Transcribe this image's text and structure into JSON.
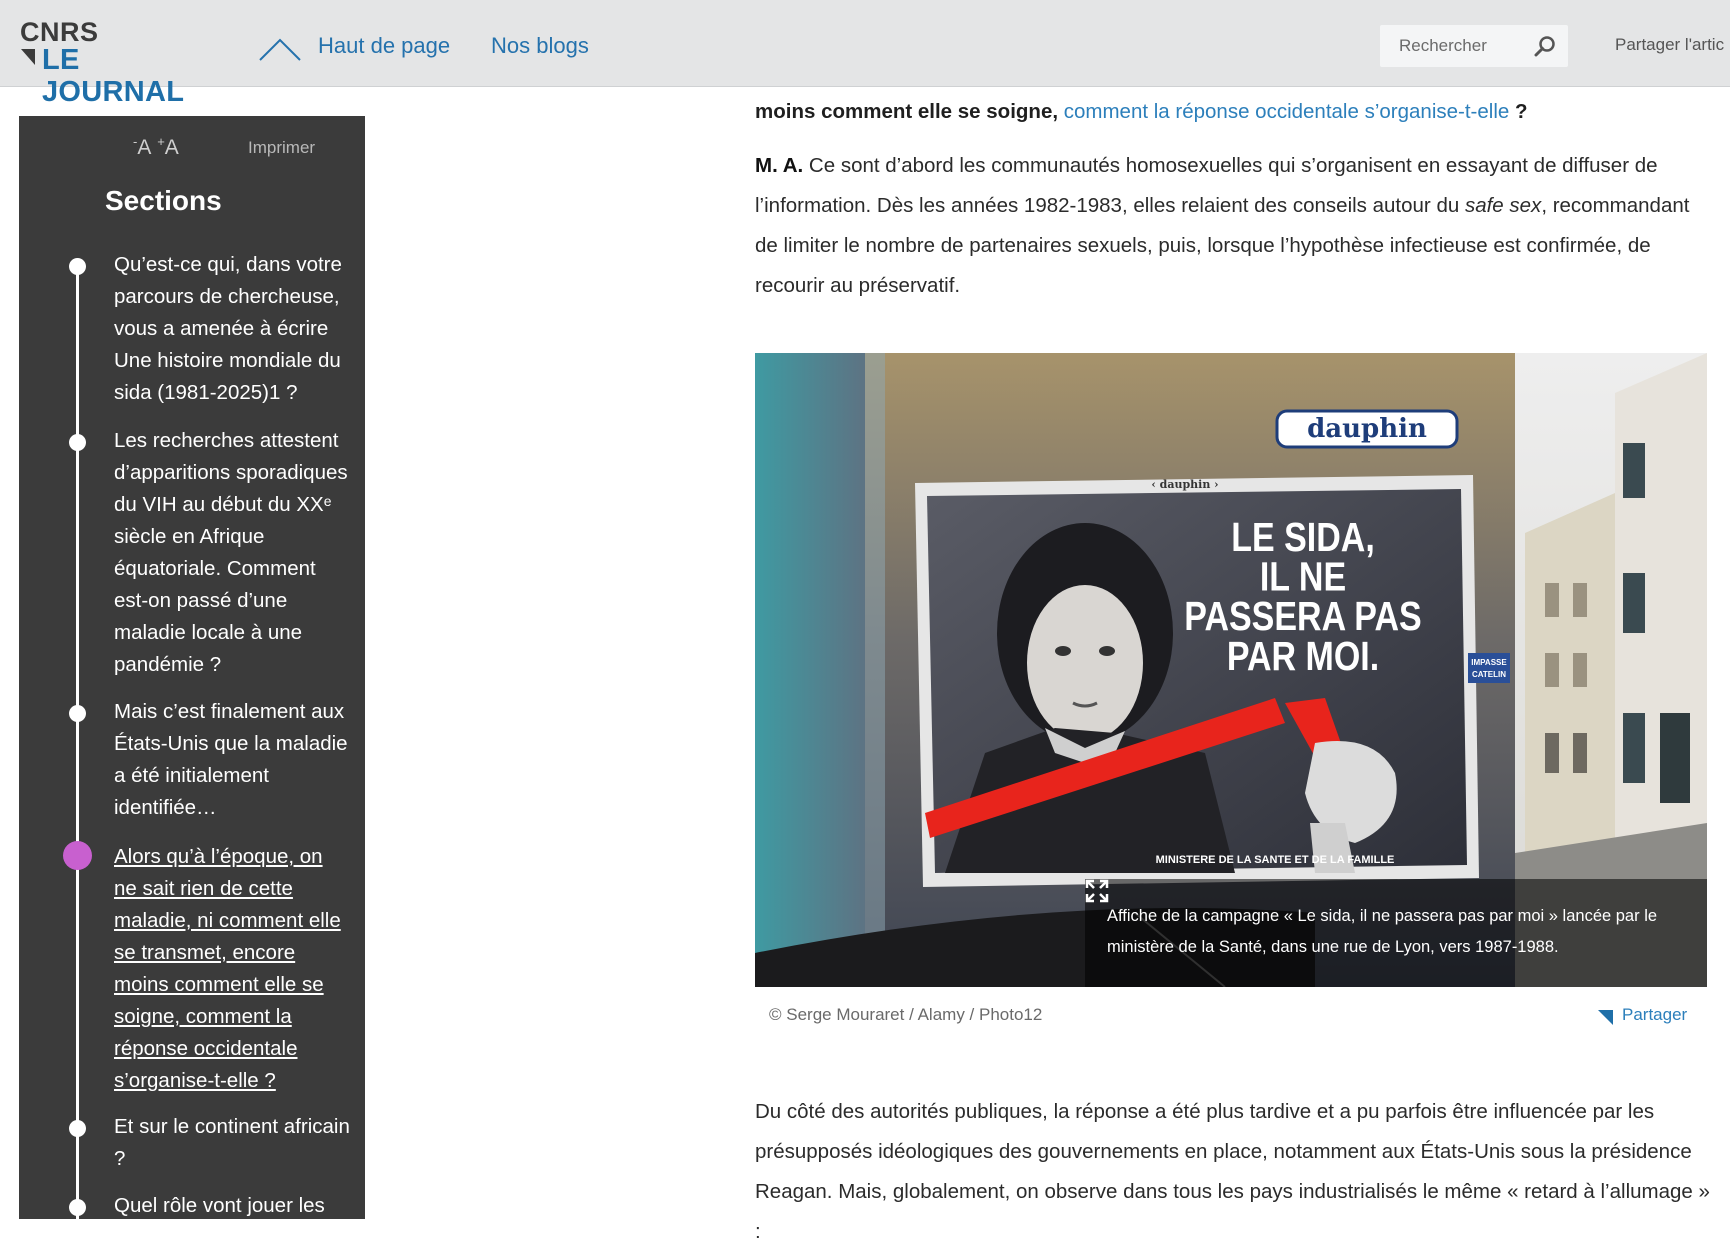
{
  "header": {
    "logo_top": "CNRS",
    "logo_bottom": "LE JOURNAL",
    "nav_top_label": "Haut de page",
    "nav_blogs_label": "Nos blogs",
    "search_placeholder": "Rechercher",
    "share_article_label": "Partager l'artic"
  },
  "sidebar": {
    "font_size_label": "A",
    "font_minus": "-",
    "font_plus": "+",
    "print_label": "Imprimer",
    "sections_title": "Sections",
    "items": [
      {
        "label": "Qu’est-ce qui, dans votre parcours de chercheuse, vous a amenée à écrire Une histoire mondiale du sida (1981-2025)1 ?"
      },
      {
        "label": "Les recherches attestent d’apparitions sporadiques du VIH au début du XXᵉ siècle en Afrique équatoriale. Comment est-on passé d’une maladie locale à une pandémie ?"
      },
      {
        "label": "Mais c’est finalement aux États-Unis que la maladie a été initialement identifiée…"
      },
      {
        "label": "Alors qu’à l’époque, on ne sait rien de cette maladie, ni comment elle se transmet, encore moins comment elle se soigne, comment la réponse occidentale s’organise-t-elle ?",
        "active": true
      },
      {
        "label": "Et sur le continent africain ?"
      },
      {
        "label": "Quel rôle vont jouer les"
      }
    ]
  },
  "article": {
    "question_bold": "moins comment elle se soigne,",
    "question_link": "comment la réponse occidentale s’organise-t-elle",
    "question_end": " ?",
    "answer_speaker": "M. A.",
    "answer_part1": " Ce sont d’abord les communautés homosexuelles qui s’organisent en essayant de diffuser de l’information. Dès les années 1982-1983, elles relaient des conseils autour du ",
    "answer_italic": "safe sex",
    "answer_part2": ", recommandant de limiter le nombre de partenaires sexuels, puis, lorsque l’hypothèse infectieuse est confirmée, de recourir au préservatif.",
    "photo_caption": "Affiche de la campagne « Le sida, il ne passera pas par moi » lancée par le ministère de la Santé, dans une rue de Lyon, vers 1987-1988.",
    "photo_credit": "© Serge Mouraret / Alamy / Photo12",
    "share_label": "Partager",
    "paragraph2": "Du côté des autorités publiques, la réponse a été plus tardive et a pu parfois être influencée par les présupposés idéologiques des gouvernements en place, notamment aux États-Unis sous la présidence Reagan. Mais, globalement, on observe dans tous les pays industrialisés le même « retard à l’allumage » :"
  },
  "photo": {
    "street_sign": "dauphin",
    "poster_brand": "‹ dauphin ›",
    "poster_slogan_1": "LE SIDA,",
    "poster_slogan_2": "IL NE",
    "poster_slogan_3": "PASSERA PAS",
    "poster_slogan_4": "PAR MOI.",
    "poster_ministry": "MINISTERE DE LA SANTE ET DE LA FAMILLE",
    "side_sign_1": "IMPASSE",
    "side_sign_2": "CATELIN"
  },
  "colors": {
    "accent_blue": "#2c7fbb",
    "sidebar_bg": "#3b3b3b",
    "active_dot": "#c860cf",
    "poster_red": "#e8241c"
  }
}
